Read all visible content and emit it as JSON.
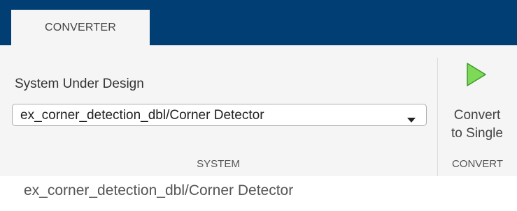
{
  "tabs": [
    {
      "label": "CONVERTER",
      "active": true
    }
  ],
  "system_section": {
    "label": "System Under Design",
    "dropdown_value": "ex_corner_detection_dbl/Corner Detector",
    "group_label": "SYSTEM"
  },
  "convert_section": {
    "button_line1": "Convert",
    "button_line2": "to Single",
    "group_label": "CONVERT",
    "icon": "play-icon"
  },
  "current_path": "ex_corner_detection_dbl/Corner Detector",
  "colors": {
    "tabbar_bg": "#003e74",
    "ribbon_bg": "#f5f5f5",
    "play_icon_fill": "#7ed957",
    "play_icon_stroke": "#3f9a2f"
  }
}
